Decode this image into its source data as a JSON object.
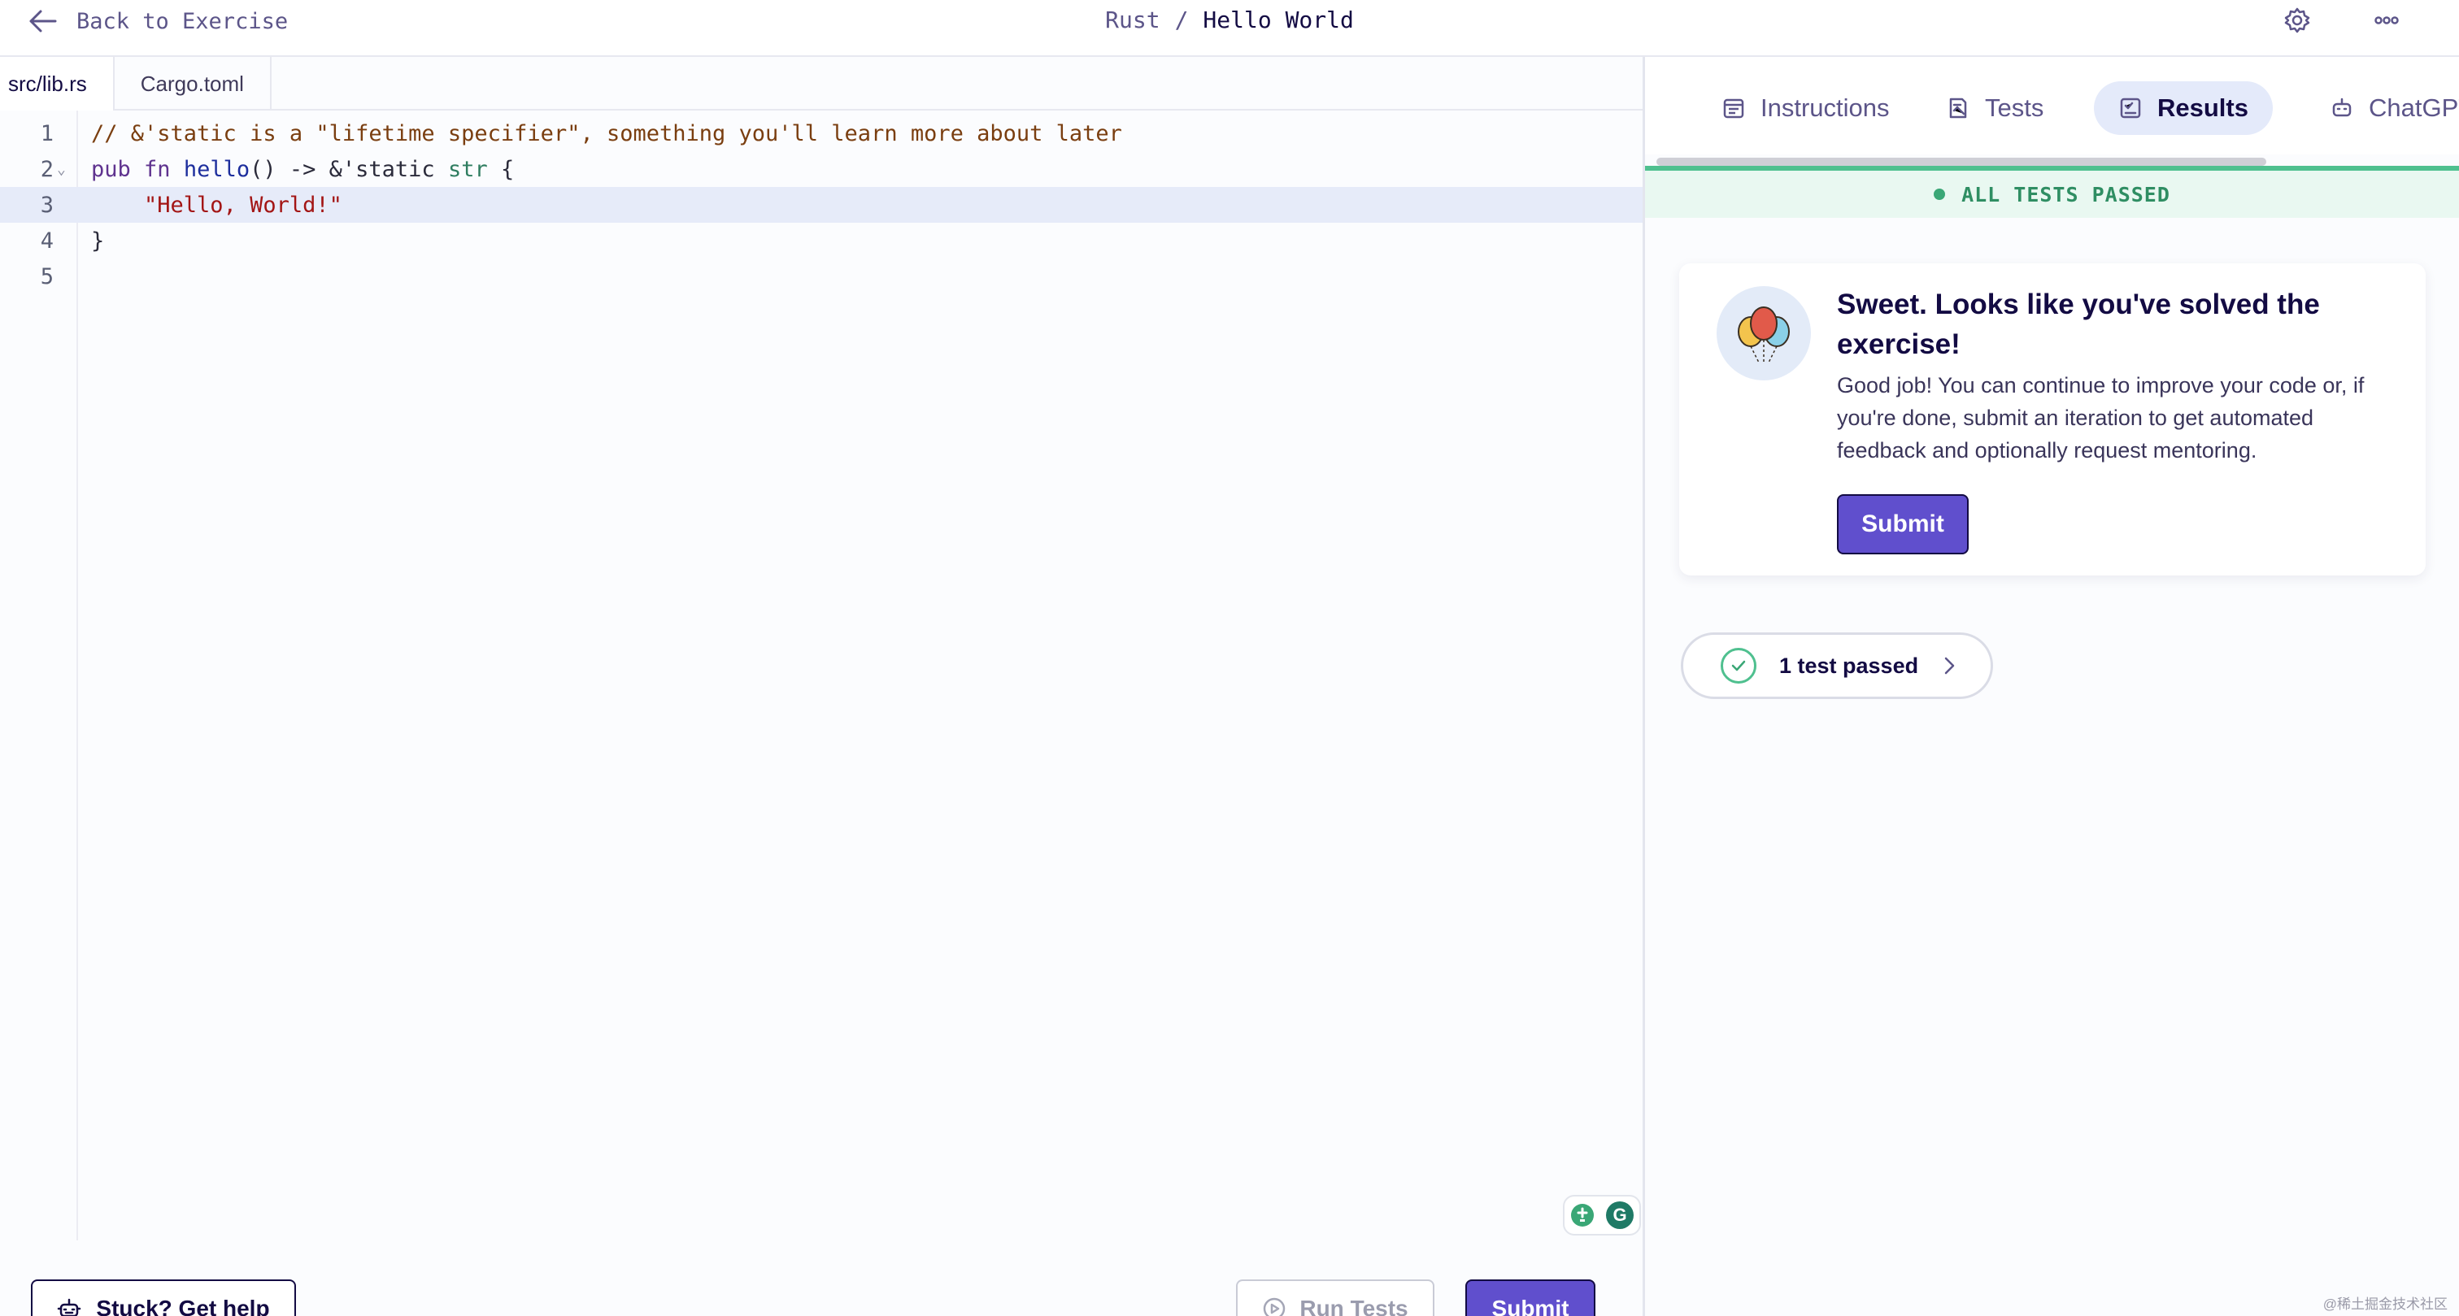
{
  "header": {
    "back_label": "Back to Exercise",
    "track": "Rust",
    "separator": "/",
    "exercise": "Hello World",
    "icons": [
      "arrow-left-icon",
      "gear-icon",
      "more-icon"
    ]
  },
  "editor": {
    "tabs": [
      {
        "label": "src/lib.rs",
        "active": true
      },
      {
        "label": "Cargo.toml",
        "active": false
      }
    ],
    "lines": [
      {
        "num": "1",
        "current": false
      },
      {
        "num": "2",
        "current": false
      },
      {
        "num": "3",
        "current": true
      },
      {
        "num": "4",
        "current": false
      },
      {
        "num": "5",
        "current": false
      }
    ],
    "code": {
      "l1_comment": "// &'static is a \"lifetime specifier\", something you'll learn more about later",
      "l2_pub": "pub",
      "l2_fn": "fn",
      "l2_name": "hello",
      "l2_parens_arrow": "() -> &'static ",
      "l2_type": "str",
      "l2_brace": " {",
      "l3_indent": "    ",
      "l3_string": "\"Hello, World!\"",
      "l4_brace": "}"
    },
    "fold_marker": "⌄",
    "grammarly_letter": "G"
  },
  "footer": {
    "stuck_label": "Stuck? Get help",
    "run_tests_label": "Run Tests",
    "submit_label": "Submit"
  },
  "panel": {
    "tabs": [
      {
        "label": "Instructions",
        "active": false
      },
      {
        "label": "Tests",
        "active": false
      },
      {
        "label": "Results",
        "active": true
      },
      {
        "label": "ChatGPT",
        "active": false
      }
    ],
    "status": "ALL TESTS PASSED",
    "card": {
      "title": "Sweet. Looks like you've solved the exercise!",
      "body": "Good job! You can continue to improve your code or, if you're done, submit an iteration to get automated feedback and optionally request mentoring.",
      "button": "Submit"
    },
    "tests_summary": "1 test passed"
  },
  "watermark": "@稀土掘金技术社区",
  "colors": {
    "accent": "#604fcd",
    "success": "#4fc08f",
    "text": "#130b43"
  }
}
